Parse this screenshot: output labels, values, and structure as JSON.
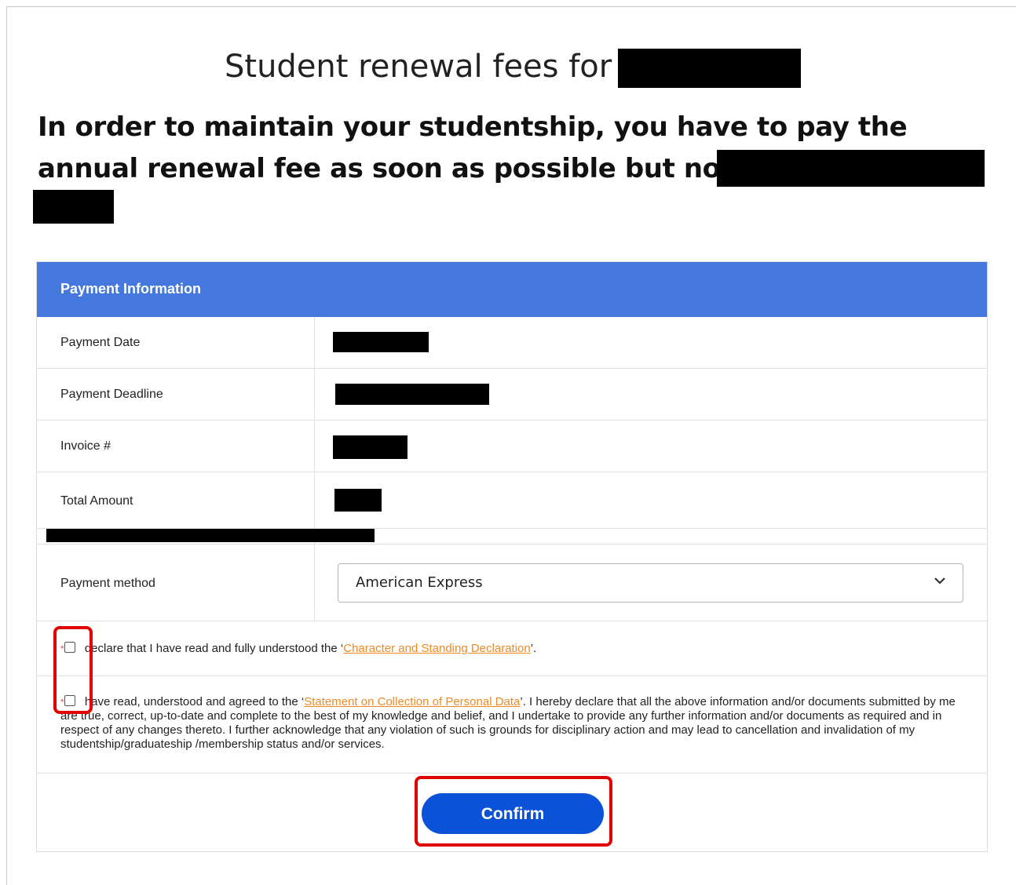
{
  "title": "Student renewal fees for",
  "subtitle": "In order to maintain your studentship, you have to pay the annual renewal fee as soon as possible but no later than",
  "panel": {
    "header": "Payment Information",
    "rows": [
      {
        "label": "Payment Date"
      },
      {
        "label": "Payment Deadline"
      },
      {
        "label": "Invoice #"
      },
      {
        "label": "Total Amount"
      }
    ],
    "payment_method_label": "Payment method",
    "payment_method_value": "American Express"
  },
  "declarations": {
    "decl1_prefix": "declare that I have read and fully understood the ‘",
    "decl1_link": "Character and Standing Declaration",
    "decl1_suffix": "’.",
    "decl2_prefix": "have read, understood and agreed to the ‘",
    "decl2_link": "Statement on Collection of Personal Data",
    "decl2_suffix": "’. I hereby declare that all the above information and/or documents submitted by me are true, correct, up-to-date and complete to the best of my knowledge and belief, and I undertake to provide any further information and/or documents as required and in respect of any changes thereto. I further acknowledge that any violation of such is grounds for disciplinary action and may lead to cancellation and invalidation of my studentship/graduateship /membership status and/or services.",
    "required_mark": "*"
  },
  "confirm_label": "Confirm",
  "colors": {
    "header_bg": "#4478dd",
    "button_bg": "#0a53d9",
    "link": "#f08a24",
    "highlight": "#e00000"
  }
}
